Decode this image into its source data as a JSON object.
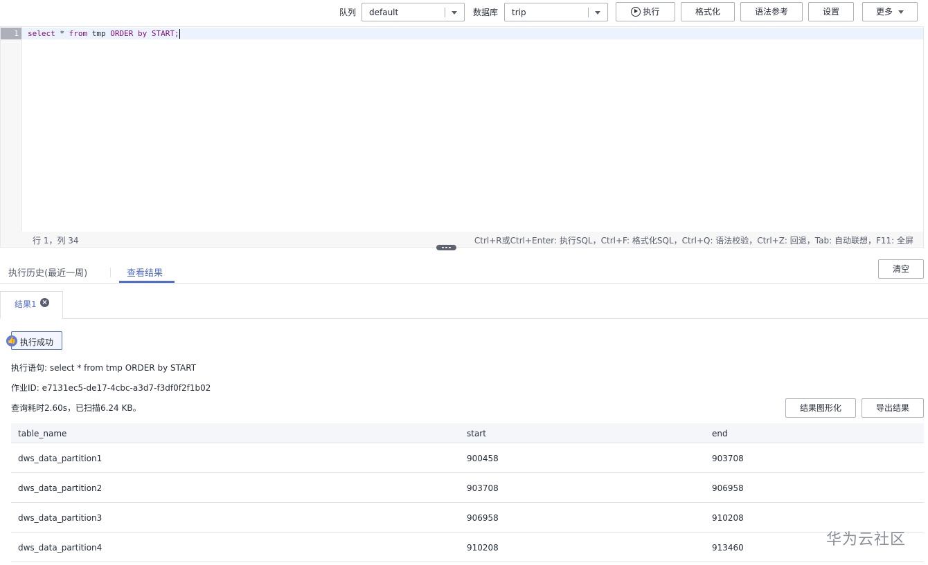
{
  "toolbar": {
    "queue_label": "队列",
    "queue_value": "default",
    "database_label": "数据库",
    "database_value": "trip",
    "execute_label": "执行",
    "format_label": "格式化",
    "syntax_ref_label": "语法参考",
    "settings_label": "设置",
    "more_label": "更多"
  },
  "editor": {
    "line_number": "1",
    "code_keyword_select": "select",
    "code_star": "*",
    "code_keyword_from": "from",
    "code_table": "tmp",
    "code_keyword_order": "ORDER",
    "code_keyword_by": "by",
    "code_column": "START",
    "code_semicolon": ";",
    "status_position": "行 1，列 34",
    "status_hint": "Ctrl+R或Ctrl+Enter: 执行SQL，Ctrl+F: 格式化SQL，Ctrl+Q: 语法校验，Ctrl+Z: 回退，Tab: 自动联想，F11: 全屏"
  },
  "tabs": {
    "history_label": "执行历史(最近一周)",
    "results_label": "查看结果",
    "clear_label": "清空"
  },
  "result_tab": {
    "label": "结果1"
  },
  "result": {
    "success_label": "执行成功",
    "statement": "执行语句: select * from tmp ORDER by START",
    "job_id": "作业ID: e7131ec5-de17-4cbc-a3d7-f3df0f2f1b02",
    "summary": "查询耗时2.60s，已扫描6.24 KB。",
    "chart_button": "结果图形化",
    "export_button": "导出结果"
  },
  "table": {
    "headers": [
      "table_name",
      "start",
      "end"
    ],
    "rows": [
      [
        "dws_data_partition1",
        "900458",
        "903708"
      ],
      [
        "dws_data_partition2",
        "903708",
        "906958"
      ],
      [
        "dws_data_partition3",
        "906958",
        "910208"
      ],
      [
        "dws_data_partition4",
        "910208",
        "913460"
      ]
    ]
  },
  "watermark": "华为云社区",
  "colors": {
    "accent": "#526ecc",
    "keyword": "#7a0e7a",
    "active_line": "#ecf3fd"
  }
}
